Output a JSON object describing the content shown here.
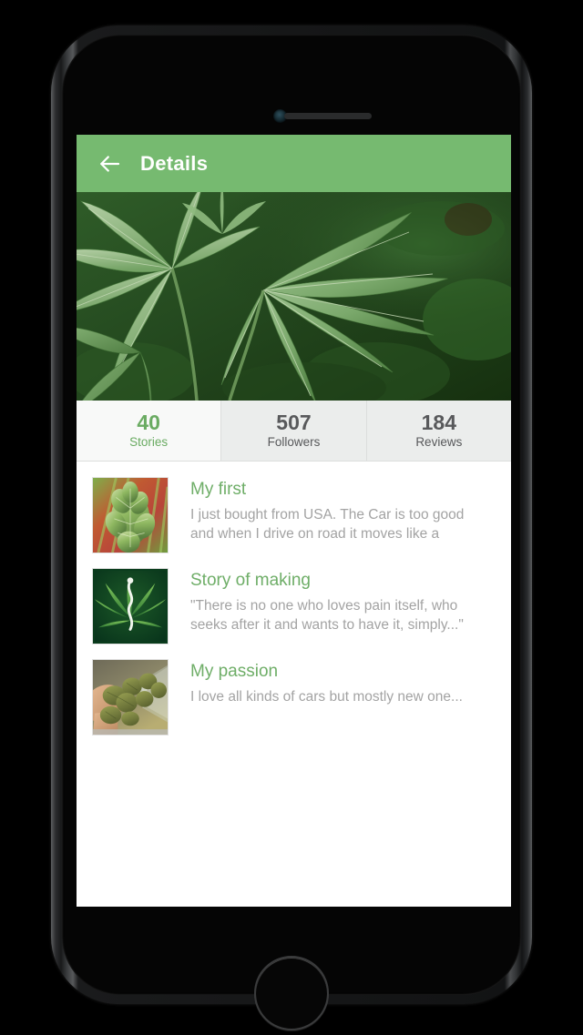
{
  "device": {
    "type": "smartphone-mockup",
    "speaker_icon": "speaker-grille",
    "camera_icon": "front-camera",
    "home_button_icon": "home-button"
  },
  "appbar": {
    "back_icon": "back-arrow-icon",
    "title": "Details"
  },
  "hero": {
    "image_alt": "cannabis-plant-leaves-closeup"
  },
  "stats": [
    {
      "value": "40",
      "label": "Stories",
      "active": true
    },
    {
      "value": "507",
      "label": "Followers",
      "active": false
    },
    {
      "value": "184",
      "label": "Reviews",
      "active": false
    }
  ],
  "stories": [
    {
      "thumb": "cannabis-bud-thumbnail",
      "title": "My first",
      "description": "I just bought from USA. The Car is too good and when I drive on road it moves like a"
    },
    {
      "thumb": "cannabis-leaf-logo-thumbnail",
      "title": "Story of making",
      "description": "\"There is no one who loves pain itself, who seeks after it and wants to have it, simply...\""
    },
    {
      "thumb": "cannabis-jar-hand-thumbnail",
      "title": "My passion",
      "description": "I love all kinds of cars but mostly new one..."
    }
  ],
  "colors": {
    "accent_green": "#76ba70",
    "title_green": "#6fae68",
    "stat_green": "#6aab62",
    "stat_gray": "#58595b",
    "desc_gray": "#a3a3a3",
    "stat_bg": "#ebedec",
    "stat_bg_active": "#f8f9f8"
  }
}
